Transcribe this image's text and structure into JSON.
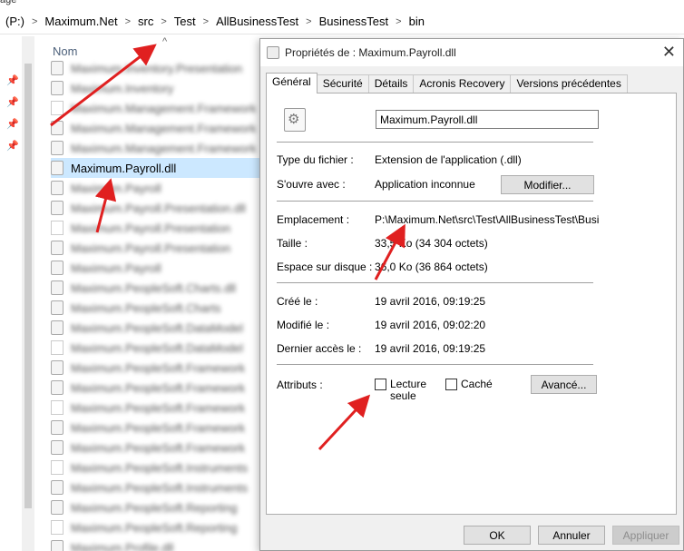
{
  "window_fragment": "age",
  "breadcrumb": {
    "items": [
      "(P:)",
      "Maximum.Net",
      "src",
      "Test",
      "AllBusinessTest",
      "BusinessTest",
      "bin"
    ],
    "separator": ">"
  },
  "explorer": {
    "column_header": "Nom",
    "sort_indicator": "^",
    "files": [
      "Maximum.Inventory.Presentation",
      "Maximum.Inventory",
      "Maximum.Management.Framework",
      "Maximum.Management.Framework",
      "Maximum.Management.Framework",
      "Maximum.Payroll.dll",
      "Maximum.Payroll",
      "Maximum.Payroll.Presentation.dll",
      "Maximum.Payroll.Presentation",
      "Maximum.Payroll.Presentation",
      "Maximum.Payroll",
      "Maximum.PeopleSoft.Charts.dll",
      "Maximum.PeopleSoft.Charts",
      "Maximum.PeopleSoft.DataModel",
      "Maximum.PeopleSoft.DataModel",
      "Maximum.PeopleSoft.Framework",
      "Maximum.PeopleSoft.Framework",
      "Maximum.PeopleSoft.Framework",
      "Maximum.PeopleSoft.Framework",
      "Maximum.PeopleSoft.Framework",
      "Maximum.PeopleSoft.Instruments",
      "Maximum.PeopleSoft.Instruments",
      "Maximum.PeopleSoft.Reporting",
      "Maximum.PeopleSoft.Reporting",
      "Maximum.Profile.dll"
    ],
    "selected_index": 5
  },
  "dialog": {
    "title": "Propriétés de : Maximum.Payroll.dll",
    "close": "✕",
    "tabs": [
      "Général",
      "Sécurité",
      "Détails",
      "Acronis Recovery",
      "Versions précédentes"
    ],
    "active_tab": 0,
    "file_name": "Maximum.Payroll.dll",
    "type_label": "Type du fichier :",
    "type_value": "Extension de l'application (.dll)",
    "opens_label": "S'ouvre avec :",
    "opens_value": "Application inconnue",
    "modify_button": "Modifier...",
    "location_label": "Emplacement :",
    "location_value": "P:\\Maximum.Net\\src\\Test\\AllBusinessTest\\BusinessTest\\bin",
    "size_label": "Taille :",
    "size_value": "33,5 Ko (34 304 octets)",
    "disk_size_label": "Espace sur disque :",
    "disk_size_value": "36,0 Ko (36 864 octets)",
    "created_label": "Créé le :",
    "created_value": "19 avril 2016, 09:19:25",
    "modified_label": "Modifié le :",
    "modified_value": "19 avril 2016, 09:02:20",
    "accessed_label": "Dernier accès le :",
    "accessed_value": "19 avril 2016, 09:19:25",
    "attributes_label": "Attributs :",
    "readonly_label_1": "Lecture",
    "readonly_label_2": "seule",
    "hidden_label": "Caché",
    "advanced_button": "Avancé...",
    "ok_button": "OK",
    "cancel_button": "Annuler",
    "apply_button": "Appliquer"
  },
  "colors": {
    "selection": "#cce8ff",
    "annotation_arrow": "#e02020"
  }
}
